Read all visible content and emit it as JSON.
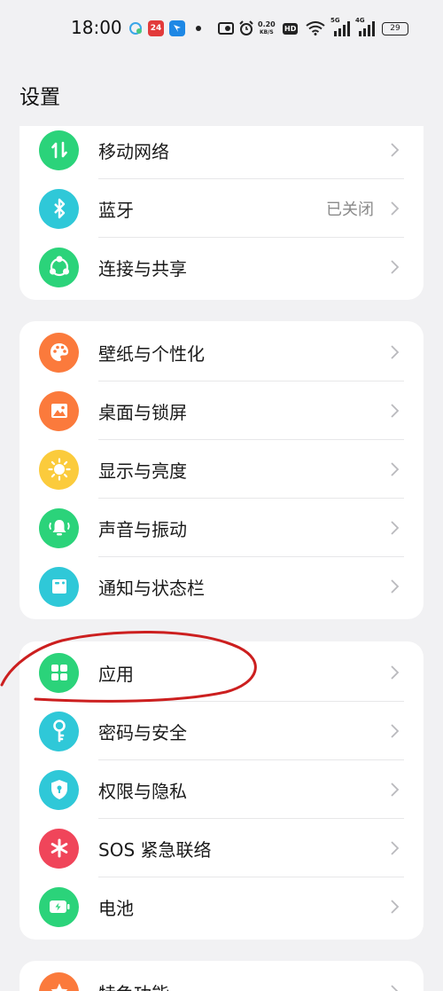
{
  "status_bar": {
    "time": "18:00",
    "netspeed_value": "0.20",
    "netspeed_unit": "KB/S",
    "hd_label": "HD",
    "signal1_label": "5G",
    "signal2_label": "4G",
    "battery": "29",
    "app_badge_1": "24"
  },
  "header": {
    "title": "设置"
  },
  "groups": [
    {
      "items": [
        {
          "label": "移动网络",
          "icon": "mobile-data-icon",
          "color": "#2bd37a"
        },
        {
          "label": "蓝牙",
          "value": "已关闭",
          "icon": "bluetooth-icon",
          "color": "#2fc8d8"
        },
        {
          "label": "连接与共享",
          "icon": "share-icon",
          "color": "#2bd37a"
        }
      ]
    },
    {
      "items": [
        {
          "label": "壁纸与个性化",
          "icon": "palette-icon",
          "color": "#fb7a3c"
        },
        {
          "label": "桌面与锁屏",
          "icon": "wallpaper-icon",
          "color": "#fb7a3c"
        },
        {
          "label": "显示与亮度",
          "icon": "brightness-icon",
          "color": "#fbcb3c"
        },
        {
          "label": "声音与振动",
          "icon": "bell-icon",
          "color": "#2bd37a"
        },
        {
          "label": "通知与状态栏",
          "icon": "notification-icon",
          "color": "#2fc8d8"
        }
      ]
    },
    {
      "items": [
        {
          "label": "应用",
          "icon": "apps-icon",
          "color": "#2bd37a"
        },
        {
          "label": "密码与安全",
          "icon": "key-icon",
          "color": "#2fc8d8"
        },
        {
          "label": "权限与隐私",
          "icon": "shield-icon",
          "color": "#2fc8d8"
        },
        {
          "label": "SOS 紧急联络",
          "icon": "sos-icon",
          "color": "#f0455a"
        },
        {
          "label": "电池",
          "icon": "battery-icon",
          "color": "#2bd37a"
        }
      ]
    },
    {
      "items": [
        {
          "label": "特色功能",
          "icon": "star-icon",
          "color": "#fb7a3c"
        }
      ]
    }
  ],
  "colors": {
    "background": "#f1f1f3",
    "card": "#ffffff",
    "annotation": "#cc1f1f"
  }
}
